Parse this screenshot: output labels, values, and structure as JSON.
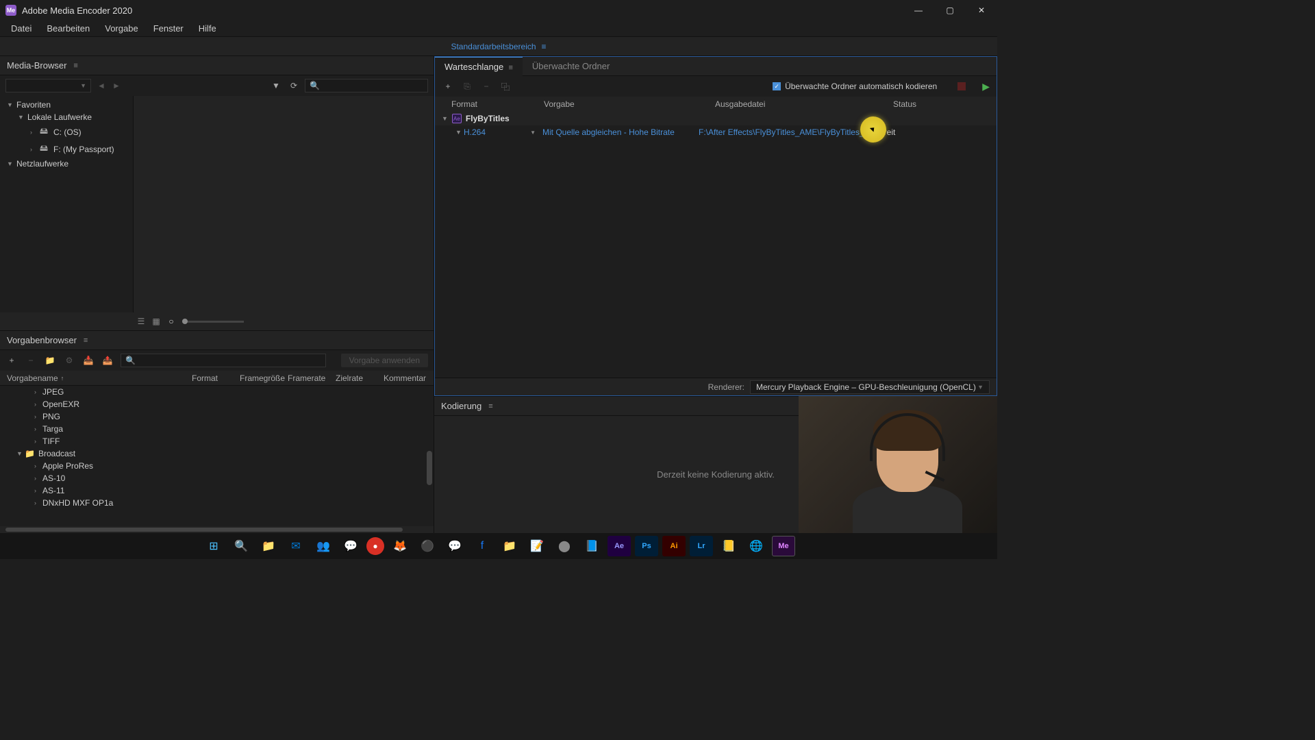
{
  "titlebar": {
    "title": "Adobe Media Encoder 2020"
  },
  "menubar": {
    "items": [
      "Datei",
      "Bearbeiten",
      "Vorgabe",
      "Fenster",
      "Hilfe"
    ]
  },
  "workspace": {
    "label": "Standardarbeitsbereich"
  },
  "mediaBrowser": {
    "title": "Media-Browser",
    "tree": {
      "favorites": "Favoriten",
      "localDrives": "Lokale Laufwerke",
      "driveC": "C: (OS)",
      "driveF": "F: (My Passport)",
      "network": "Netzlaufwerke"
    }
  },
  "presetBrowser": {
    "title": "Vorgabenbrowser",
    "applyLabel": "Vorgabe anwenden",
    "columns": {
      "name": "Vorgabename",
      "format": "Format",
      "frameSize": "Framegröße",
      "framerate": "Framerate",
      "targetRate": "Zielrate",
      "comment": "Kommentar"
    },
    "items": {
      "jpeg": "JPEG",
      "openexr": "OpenEXR",
      "png": "PNG",
      "targa": "Targa",
      "tiff": "TIFF",
      "broadcast": "Broadcast",
      "prores": "Apple ProRes",
      "as10": "AS-10",
      "as11": "AS-11",
      "dnxhd": "DNxHD MXF OP1a"
    }
  },
  "queue": {
    "tabQueue": "Warteschlange",
    "tabWatch": "Überwachte Ordner",
    "autoEncode": "Überwachte Ordner automatisch kodieren",
    "columns": {
      "format": "Format",
      "preset": "Vorgabe",
      "output": "Ausgabedatei",
      "status": "Status"
    },
    "comp": {
      "name": "FlyByTitles"
    },
    "output": {
      "format": "H.264",
      "preset": "Mit Quelle abgleichen - Hohe Bitrate",
      "file": "F:\\After Effects\\FlyByTitles_AME\\FlyByTitles_2.mp4",
      "status": "Bereit"
    },
    "rendererLabel": "Renderer:",
    "rendererValue": "Mercury Playback Engine – GPU-Beschleunigung (OpenCL)"
  },
  "encoding": {
    "title": "Kodierung",
    "idle": "Derzeit keine Kodierung aktiv."
  }
}
